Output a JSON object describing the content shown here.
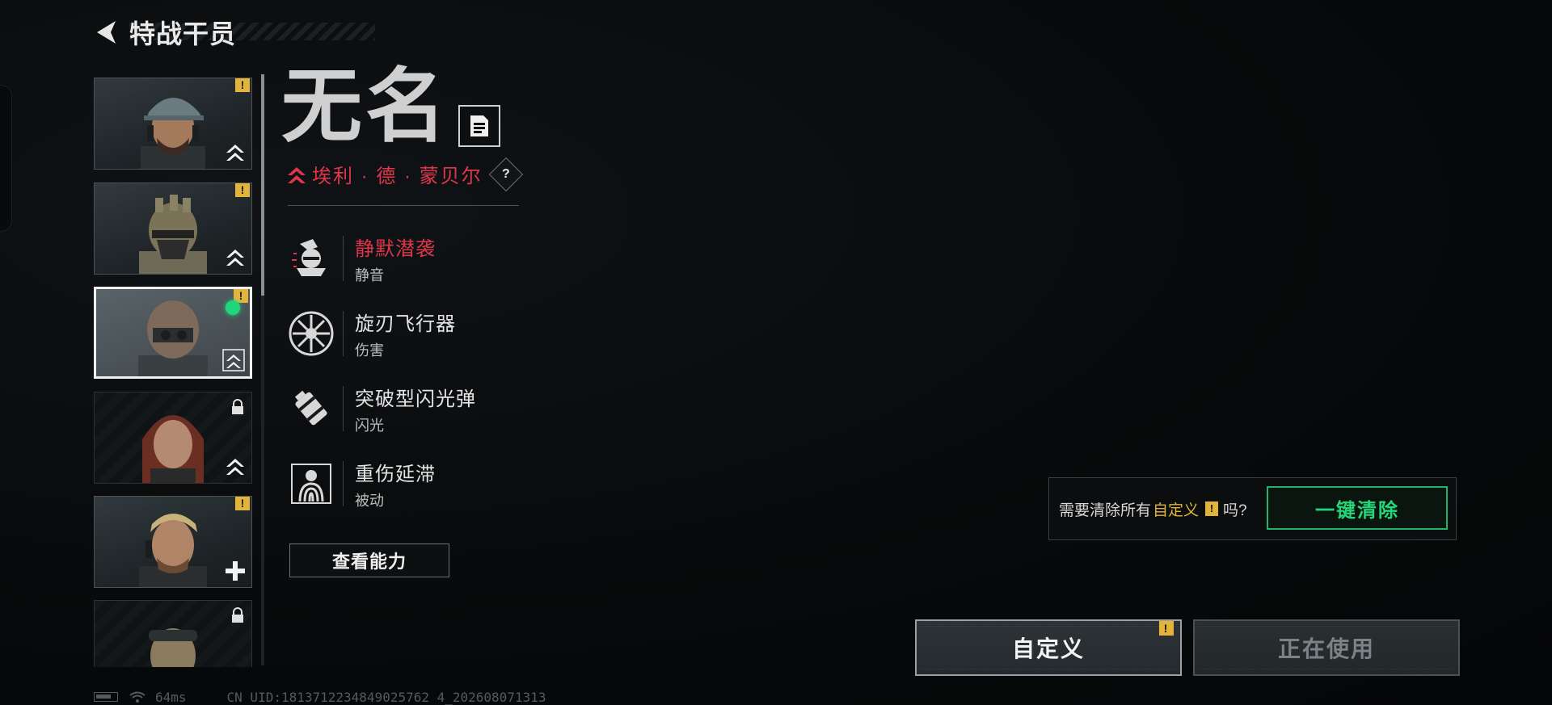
{
  "header": {
    "title": "特战干员"
  },
  "operators": [
    {
      "top": 0,
      "state": "warning",
      "rank": "chevron"
    },
    {
      "top": 0,
      "state": "warning",
      "rank": "chevron"
    },
    {
      "top": 0,
      "state": "selected",
      "rank": "chevron"
    },
    {
      "top": 0,
      "state": "locked",
      "rank": "chevron"
    },
    {
      "top": 0,
      "state": "warning",
      "rank": "plus"
    },
    {
      "top": 0,
      "state": "locked",
      "rank": "none"
    }
  ],
  "operator": {
    "name": "无名",
    "faction": "埃利 · 德 · 蒙贝尔",
    "help_label": "?"
  },
  "abilities": [
    {
      "name": "静默潜袭",
      "type": "静音",
      "icon": "stealth-icon",
      "active": true
    },
    {
      "name": "旋刃飞行器",
      "type": "伤害",
      "icon": "blade-drone-icon",
      "active": false
    },
    {
      "name": "突破型闪光弹",
      "type": "闪光",
      "icon": "flashbang-icon",
      "active": false
    },
    {
      "name": "重伤延滞",
      "type": "被动",
      "icon": "fingerprint-target-icon",
      "active": false
    }
  ],
  "view_abilities_label": "查看能力",
  "clear_prompt": {
    "prefix": "需要清除所有",
    "highlight": "自定义",
    "warn": "!",
    "suffix": "吗?",
    "button_label": "一键清除"
  },
  "buttons": {
    "customize": "自定义",
    "in_use": "正在使用",
    "customize_warn": "!"
  },
  "status_bar": {
    "ping": "64ms",
    "uid": "CN UID:1813712234849025762 4_202608071313"
  },
  "colors": {
    "accent_red": "#e0364a",
    "accent_green": "#24d878",
    "warning_yellow": "#e2b53a"
  }
}
